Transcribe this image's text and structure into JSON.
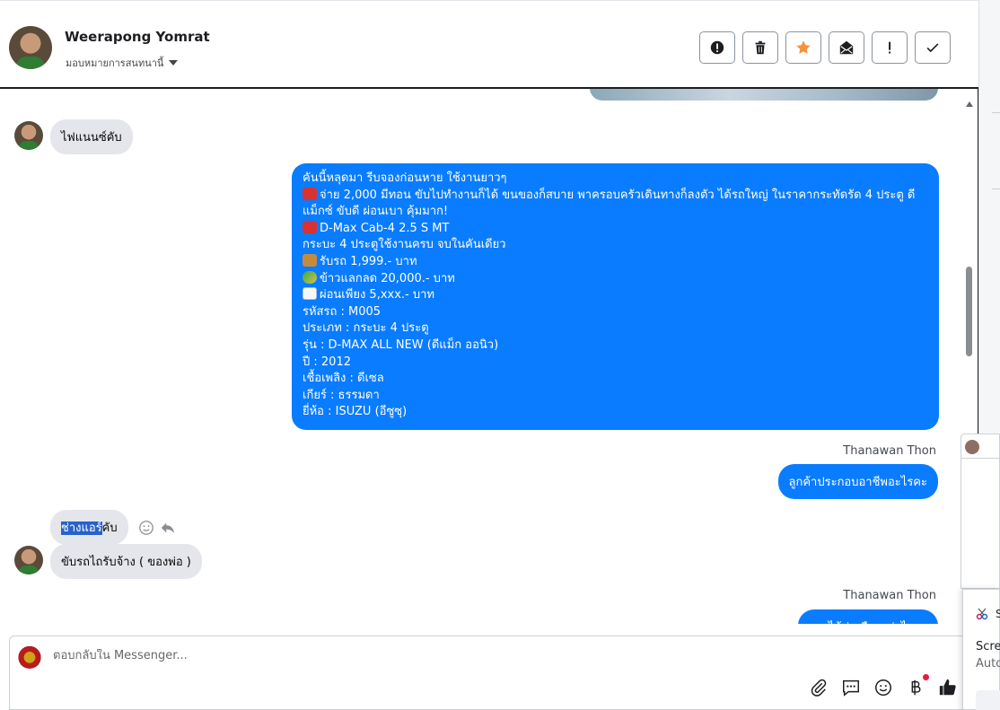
{
  "header": {
    "contact_name": "Weerapong Yomrat",
    "assign_label": "มอบหมายการสนทนานี้",
    "actions": [
      {
        "name": "spam-icon"
      },
      {
        "name": "trash-icon"
      },
      {
        "name": "star-icon",
        "color": "#f7923a"
      },
      {
        "name": "mark-unread-icon"
      },
      {
        "name": "follow-up-icon"
      },
      {
        "name": "done-check-icon"
      }
    ]
  },
  "messages": {
    "in_1": "ไฟแนนซ์คับ",
    "out_big": [
      "คันนี้หลุดมา รีบจองก่อนหาย ใช้งานยาวๆ",
      "จ่าย 2,000 มีทอน ขับไปทำงานก็ได้ ขนของก็สบาย พาครอบครัวเดินทางก็ลงตัว ได้รถใหญ่ ในราคากระทัดรัด 4 ประตู ดี",
      "แม็กซ์ ขับดี ผ่อนเบา คุ้มมาก!",
      "D-Max Cab-4 2.5 S MT",
      "กระบะ 4 ประตูใช้งานครบ จบในคันเดียว",
      "รับรถ 1,999.- บาท",
      "ข้าวแลกลด 20,000.- บาท",
      "ผ่อนเพียง 5,xxx.- บาท",
      "รหัสรถ : M005",
      "ประเภท : กระบะ 4 ประตู",
      "รุ่น : D-MAX ALL NEW (ดีแม็ก ออนิว)",
      "ปี : 2012",
      "เชื้อเพลิง : ดีเซล",
      "เกียร์ : ธรรมดา",
      "ยี่ห้อ : ISUZU (อีซูซุ)"
    ],
    "sender_1": "Thanawan Thon",
    "out_2": "ลูกค้าประกอบอาชีพอะไรคะ",
    "in_2_selected": "ช่างแอร์",
    "in_2_rest": "คับ",
    "in_3": "ขับรถไถรับจ้าง (  ของพ่อ )",
    "sender_2": "Thanawan Thon",
    "out_3_partial": "รายได้ต่อเดือนเท่าไรคะ"
  },
  "composer": {
    "placeholder": "ตอบกลับใน Messenger..."
  },
  "overlay": {
    "toast_letter": "S",
    "toast_line1": "Scree",
    "toast_line2": "Auto"
  },
  "colors": {
    "outgoing_bubble": "#0a7cff",
    "incoming_bubble": "#e4e6eb",
    "like_thumb": "#1c1e21"
  }
}
